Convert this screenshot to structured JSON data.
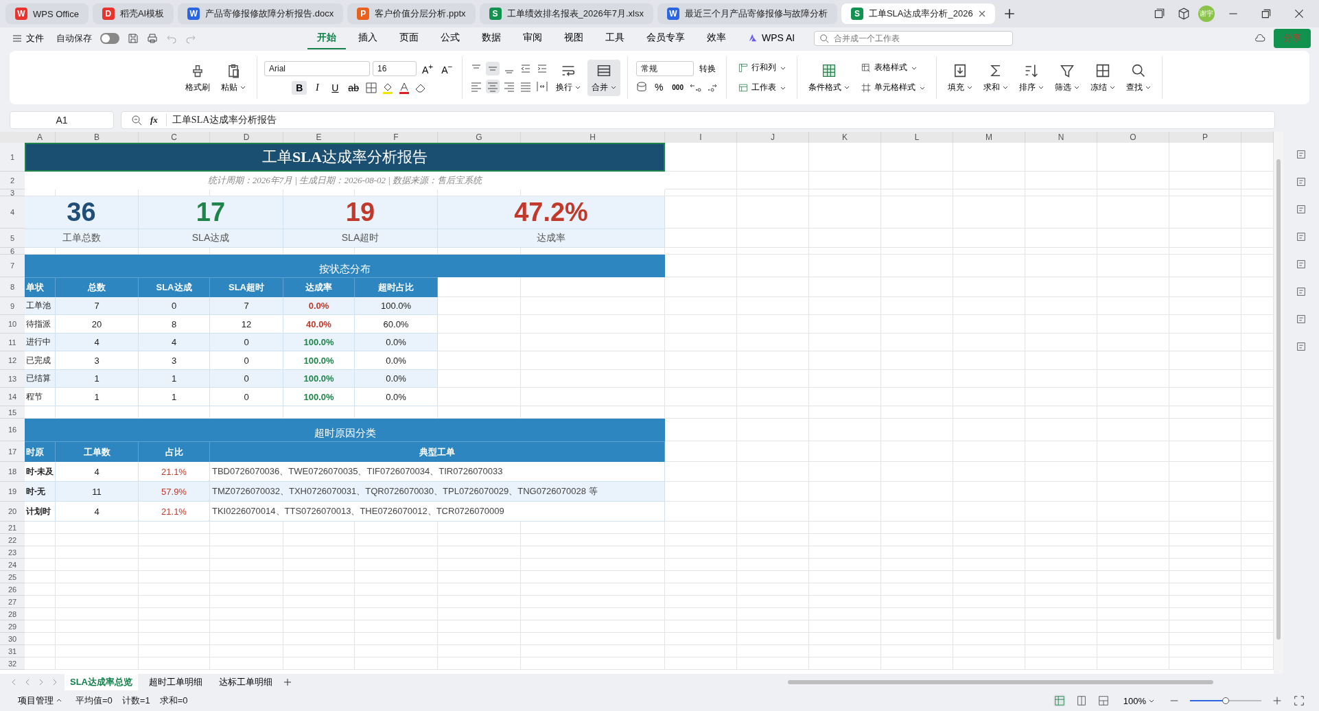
{
  "title_tabs": [
    {
      "label": "WPS Office",
      "kind": "wps",
      "badge": "W",
      "selected": false
    },
    {
      "label": "稻壳AI模板",
      "kind": "ai",
      "badge": "D",
      "selected": false
    },
    {
      "label": "产品寄修报修故障分析报告.docx",
      "kind": "doc",
      "badge": "W",
      "selected": false
    },
    {
      "label": "客户价值分层分析.pptx",
      "kind": "ppt",
      "badge": "P",
      "selected": false
    },
    {
      "label": "工单绩效排名报表_2026年7月.xlsx",
      "kind": "xls",
      "badge": "S",
      "selected": false
    },
    {
      "label": "最近三个月产品寄修报修与故障分析",
      "kind": "doc",
      "badge": "W",
      "selected": false
    },
    {
      "label": "工单SLA达成率分析_2026",
      "kind": "xls",
      "badge": "S",
      "selected": true
    }
  ],
  "avatar": "谢宇",
  "menu": {
    "file": "文件",
    "autosave": {
      "label": "自动保存",
      "on": false
    },
    "tabs": [
      {
        "label": "开始",
        "selected": true
      },
      {
        "label": "插入",
        "selected": false
      },
      {
        "label": "页面",
        "selected": false
      },
      {
        "label": "公式",
        "selected": false
      },
      {
        "label": "数据",
        "selected": false
      },
      {
        "label": "审阅",
        "selected": false
      },
      {
        "label": "视图",
        "selected": false
      },
      {
        "label": "工具",
        "selected": false
      },
      {
        "label": "会员专享",
        "selected": false
      },
      {
        "label": "效率",
        "selected": false
      }
    ],
    "ai": "WPS AI",
    "search": {
      "placeholder": "合并成一个工作表"
    },
    "share": "分享"
  },
  "ribbon": {
    "clipboard": [
      {
        "label": "格式刷",
        "dropdown": false
      },
      {
        "label": "粘贴",
        "dropdown": true
      }
    ],
    "font": {
      "family": "Arial",
      "size": "16",
      "grow": "A$^{+}$",
      "shrink": "A$^{−}$",
      "format_buttons": [
        {
          "glyph": "B",
          "kind": "bold",
          "selected": true
        },
        {
          "glyph": "I",
          "kind": "italic",
          "selected": false
        },
        {
          "glyph": "U",
          "kind": "underline",
          "selected": false
        },
        {
          "glyph": "ab",
          "kind": "strike",
          "selected": false
        }
      ]
    },
    "align_top": [
      {
        "selected": false
      },
      {
        "selected": true
      },
      {
        "selected": false
      },
      {
        "selected": false
      },
      {
        "selected": false
      }
    ],
    "align_bottom": [
      {
        "selected": false
      },
      {
        "selected": true
      },
      {
        "selected": false
      },
      {
        "selected": false
      },
      {
        "selected": false
      }
    ],
    "align_buttons": [
      {
        "label": "换行",
        "selected": false
      },
      {
        "label": "合并",
        "selected": true
      }
    ],
    "number_format": "常规",
    "convert": "转换",
    "percent": "%",
    "thousands": "000",
    "cells": [
      "行和列",
      "工作表"
    ],
    "conditional": "条件格式",
    "styles": [
      "表格样式",
      "单元格样式"
    ],
    "tools": [
      "填充",
      "求和",
      "排序",
      "筛选",
      "冻结",
      "查找"
    ]
  },
  "formula_bar": {
    "cell_ref": "A1",
    "function_label": "fx",
    "formula": "工单SLA达成率分析报告"
  },
  "columns": [
    "A",
    "B",
    "C",
    "D",
    "E",
    "F",
    "G",
    "H",
    "I",
    "J",
    "K",
    "L",
    "M",
    "N",
    "O",
    "P"
  ],
  "rows": [
    "1",
    "2",
    "3",
    "4",
    "5",
    "6",
    "7",
    "8",
    "9",
    "10",
    "11",
    "12",
    "13",
    "14",
    "15",
    "16",
    "17",
    "18",
    "19",
    "20",
    "21",
    "22",
    "23",
    "24",
    "25",
    "26",
    "27",
    "28",
    "29",
    "30",
    "31",
    "32"
  ],
  "report": {
    "title": "工单**SLA**达成率分析报告",
    "title_selected": true,
    "subtitle": "统计周期：2026年7月 | 生成日期：2026-08-02 | 数据来源：售后宝系统",
    "kpis": [
      {
        "value": "36",
        "label": "工单总数",
        "color": "#1f4e79"
      },
      {
        "value": "17",
        "label": "SLA达成",
        "color": "#1e8449"
      },
      {
        "value": "19",
        "label": "SLA超时",
        "color": "#c0392b"
      },
      {
        "value": "47.2%",
        "label": "达成率",
        "color": "#c0392b"
      }
    ],
    "status_table": {
      "title": "按状态分布",
      "columns": [
        "单状",
        "总数",
        "SLA达成",
        "SLA超时",
        "达成率",
        "超时占比"
      ],
      "rows": [
        {
          "cells": [
            "工单池",
            "7",
            "0",
            "7",
            "0.0%",
            "100.0%"
          ],
          "meets_target": false
        },
        {
          "cells": [
            "待指派",
            "20",
            "8",
            "12",
            "40.0%",
            "60.0%"
          ],
          "meets_target": false
        },
        {
          "cells": [
            "进行中",
            "4",
            "4",
            "0",
            "100.0%",
            "0.0%"
          ],
          "meets_target": true
        },
        {
          "cells": [
            "已完成",
            "3",
            "3",
            "0",
            "100.0%",
            "0.0%"
          ],
          "meets_target": true
        },
        {
          "cells": [
            "已结算",
            "1",
            "1",
            "0",
            "100.0%",
            "0.0%"
          ],
          "meets_target": true
        },
        {
          "cells": [
            "程节",
            "1",
            "1",
            "0",
            "100.0%",
            "0.0%"
          ],
          "meets_target": true
        }
      ]
    },
    "reason_table": {
      "title": "超时原因分类",
      "columns": [
        "时原",
        "工单数",
        "占比",
        "典型工单"
      ],
      "rows": [
        {
          "reason": "时-未及",
          "count": "4",
          "share": "21.1%",
          "tickets": "TBD0726070036、TWE0726070035、TIF0726070034、TIR0726070033"
        },
        {
          "reason": "时-无",
          "count": "11",
          "share": "57.9%",
          "tickets": "TMZ0726070032、TXH0726070031、TQR0726070030、TPL0726070029、TNG0726070028 等"
        },
        {
          "reason": "计划时",
          "count": "4",
          "share": "21.1%",
          "tickets": "TKI0226070014、TTS0726070013、THE0726070012、TCR0726070009"
        }
      ]
    }
  },
  "sheet_tabs": [
    {
      "label": "SLA达成率总览",
      "selected": true
    },
    {
      "label": "超时工单明细",
      "selected": false
    },
    {
      "label": "达标工单明细",
      "selected": false
    }
  ],
  "status_bar": {
    "project": "项目管理",
    "average": "平均值=0",
    "count": "计数=1",
    "sum": "求和=0",
    "zoom": "100%",
    "zoom_slider": {
      "level": 0.5
    },
    "views": [
      {
        "selected": true
      },
      {
        "selected": false
      },
      {
        "selected": false
      }
    ]
  }
}
